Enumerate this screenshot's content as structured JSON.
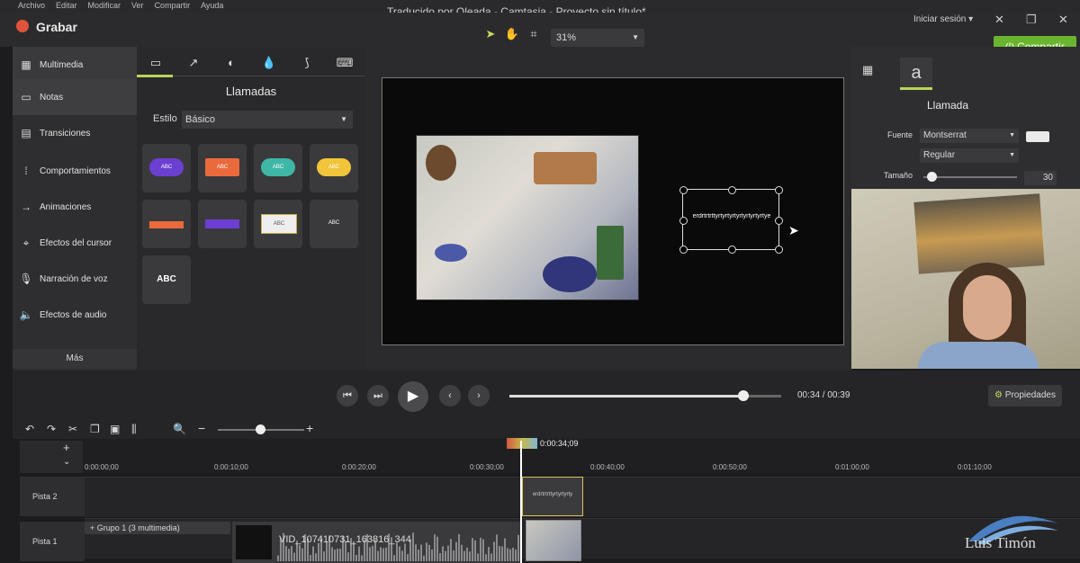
{
  "menu": [
    "Archivo",
    "Editar",
    "Modificar",
    "Ver",
    "Compartir",
    "Ayuda"
  ],
  "app": {
    "record_label": "Grabar",
    "title": "Traducido por Oleada - Camtasia - Proyecto sin título*",
    "signin": "Iniciar sesión ▾",
    "share": "Compartir"
  },
  "toolbar": {
    "zoom": "31%"
  },
  "sidebar": {
    "items": [
      {
        "label": "Multimedia",
        "icon": "film-icon"
      },
      {
        "label": "Notas",
        "icon": "note-icon"
      },
      {
        "label": "Transiciones",
        "icon": "transition-icon"
      },
      {
        "label": "Comportamientos",
        "icon": "behavior-icon"
      },
      {
        "label": "Animaciones",
        "icon": "animation-icon"
      },
      {
        "label": "Efectos del cursor",
        "icon": "cursor-icon"
      },
      {
        "label": "Narración de voz",
        "icon": "microphone-icon"
      },
      {
        "label": "Efectos de audio",
        "icon": "speaker-icon"
      }
    ],
    "more": "Más"
  },
  "annotations": {
    "title": "Llamadas",
    "style_label": "Estilo",
    "style_value": "Básico",
    "callouts": [
      "ABC",
      "ABC",
      "ABC",
      "ABC",
      "",
      "",
      "ABC",
      "ABC",
      "ABC"
    ]
  },
  "canvas": {
    "textbox_text": "erdrtrtrttyrtyrtyrtyrtyrtyrtyrtye"
  },
  "properties": {
    "title": "Llamada",
    "font_label": "Fuente",
    "font_value": "Montserrat",
    "weight_value": "Regular",
    "size_label": "Tamaño",
    "size_value": "30"
  },
  "playback": {
    "current": "00:34",
    "total": "00:39",
    "progress": 0.86,
    "props_button": "Propiedades"
  },
  "timeline": {
    "playhead_time": "0:00:34;09",
    "ticks": [
      "0:00:00;00",
      "0:00:10;00",
      "0:00:20;00",
      "0:00:30;00",
      "0:00:40;00",
      "0:00:50;00",
      "0:01:00;00",
      "0:01:10;00"
    ],
    "tracks": [
      {
        "name": "Pista 2"
      },
      {
        "name": "Pista 1"
      }
    ],
    "text_clip": "erdrtrtrttyrtyrtyrty",
    "group_label": "+  Grupo 1  (3 multimedia)",
    "video_clip": "VID_107410731_163816_344"
  },
  "watermark": {
    "text": "Luis Timón"
  }
}
